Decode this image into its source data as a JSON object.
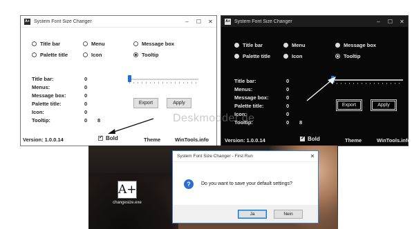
{
  "app": {
    "title": "System Font Size Changer",
    "app_icon": "A+",
    "caption_buttons": {
      "minimize": "–",
      "maximize": "☐",
      "close": "✕"
    }
  },
  "options": {
    "title_bar": "Title bar",
    "menu": "Menu",
    "message_box": "Message box",
    "palette_title": "Palette title",
    "icon": "Icon",
    "tooltip": "Tooltip",
    "selected": "tooltip"
  },
  "fields": {
    "title_bar": {
      "label": "Title bar:",
      "value": "0"
    },
    "menus": {
      "label": "Menus:",
      "value": "0"
    },
    "message_box": {
      "label": "Message box:",
      "value": "0"
    },
    "palette_title": {
      "label": "Palette title:",
      "value": "0"
    },
    "icon": {
      "label": "Icon:",
      "value": "0"
    },
    "tooltip": {
      "label": "Tooltip:",
      "value": "0",
      "extra": "8"
    }
  },
  "buttons": {
    "export": "Export",
    "apply": "Apply"
  },
  "footer": {
    "version": "Version: 1.0.0.14",
    "bold": "Bold",
    "bold_checked": true,
    "theme": "Theme",
    "link": "WinTools.info"
  },
  "slider": {
    "position": 0
  },
  "watermark": "Deskmodder.de",
  "first_run": {
    "title": "System Font Size Changer - First Run",
    "message": "Do you want to save your default settings?",
    "yes": "Ja",
    "no": "Nein",
    "icon_label": "?"
  },
  "desktop": {
    "shortcut_icon": "A+",
    "shortcut_label": "changesize.exe"
  },
  "colors": {
    "accent": "#1e6fd9",
    "dark_bg": "#080808",
    "light_bg": "#ffffff"
  }
}
